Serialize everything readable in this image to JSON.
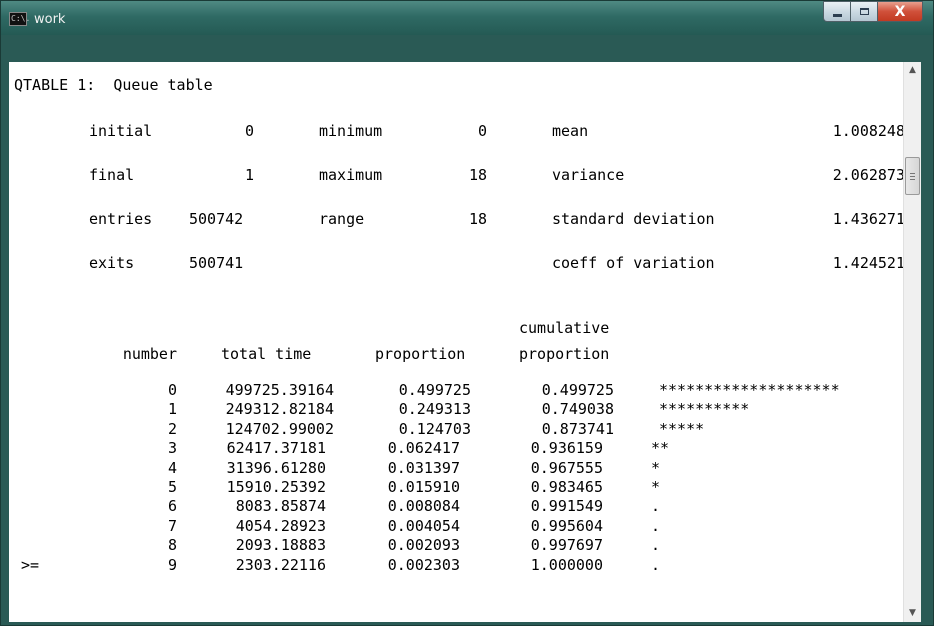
{
  "window": {
    "title": "work",
    "icon": "cmd-icon",
    "icon_text": "C:\\."
  },
  "controls": {
    "minimize_icon": "minimize-icon",
    "maximize_icon": "maximize-icon",
    "close_glyph": "X"
  },
  "report": {
    "header": "QTABLE 1:  Queue table",
    "stats": {
      "initial_label": "initial",
      "initial_value": "0",
      "final_label": "final",
      "final_value": "1",
      "entries_label": "entries",
      "entries_value": "500742",
      "exits_label": "exits",
      "exits_value": "500741",
      "minimum_label": "minimum",
      "minimum_value": "0",
      "maximum_label": "maximum",
      "maximum_value": "18",
      "range_label": "range",
      "range_value": "18",
      "mean_label": "mean",
      "mean_value": "1.008248",
      "variance_label": "variance",
      "variance_value": "2.062873",
      "sd_label": "standard deviation",
      "sd_value": "1.436271",
      "cv_label": "coeff of variation",
      "cv_value": "1.424521"
    },
    "columns": {
      "number": "number",
      "total_time": "total time",
      "proportion": "proportion",
      "cumulative_line1": "cumulative",
      "cumulative_line2": "proportion"
    },
    "rows": [
      {
        "prefix": "",
        "number": "0",
        "total_time": "499725.39164",
        "proportion": "0.499725",
        "cumulative": "0.499725",
        "bar": "********************"
      },
      {
        "prefix": "",
        "number": "1",
        "total_time": "249312.82184",
        "proportion": "0.249313",
        "cumulative": "0.749038",
        "bar": "**********"
      },
      {
        "prefix": "",
        "number": "2",
        "total_time": "124702.99002",
        "proportion": "0.124703",
        "cumulative": "0.873741",
        "bar": "*****"
      },
      {
        "prefix": "",
        "number": "3",
        "total_time": "62417.37181",
        "proportion": "0.062417",
        "cumulative": "0.936159",
        "bar": "**"
      },
      {
        "prefix": "",
        "number": "4",
        "total_time": "31396.61280",
        "proportion": "0.031397",
        "cumulative": "0.967555",
        "bar": "*"
      },
      {
        "prefix": "",
        "number": "5",
        "total_time": "15910.25392",
        "proportion": "0.015910",
        "cumulative": "0.983465",
        "bar": "*"
      },
      {
        "prefix": "",
        "number": "6",
        "total_time": "8083.85874",
        "proportion": "0.008084",
        "cumulative": "0.991549",
        "bar": "."
      },
      {
        "prefix": "",
        "number": "7",
        "total_time": "4054.28923",
        "proportion": "0.004054",
        "cumulative": "0.995604",
        "bar": "."
      },
      {
        "prefix": "",
        "number": "8",
        "total_time": "2093.18883",
        "proportion": "0.002093",
        "cumulative": "0.997697",
        "bar": "."
      },
      {
        "prefix": ">=",
        "number": "9",
        "total_time": "2303.22116",
        "proportion": "0.002303",
        "cumulative": "1.000000",
        "bar": "."
      }
    ]
  },
  "scrollbar": {
    "up_glyph": "▲",
    "down_glyph": "▼"
  }
}
